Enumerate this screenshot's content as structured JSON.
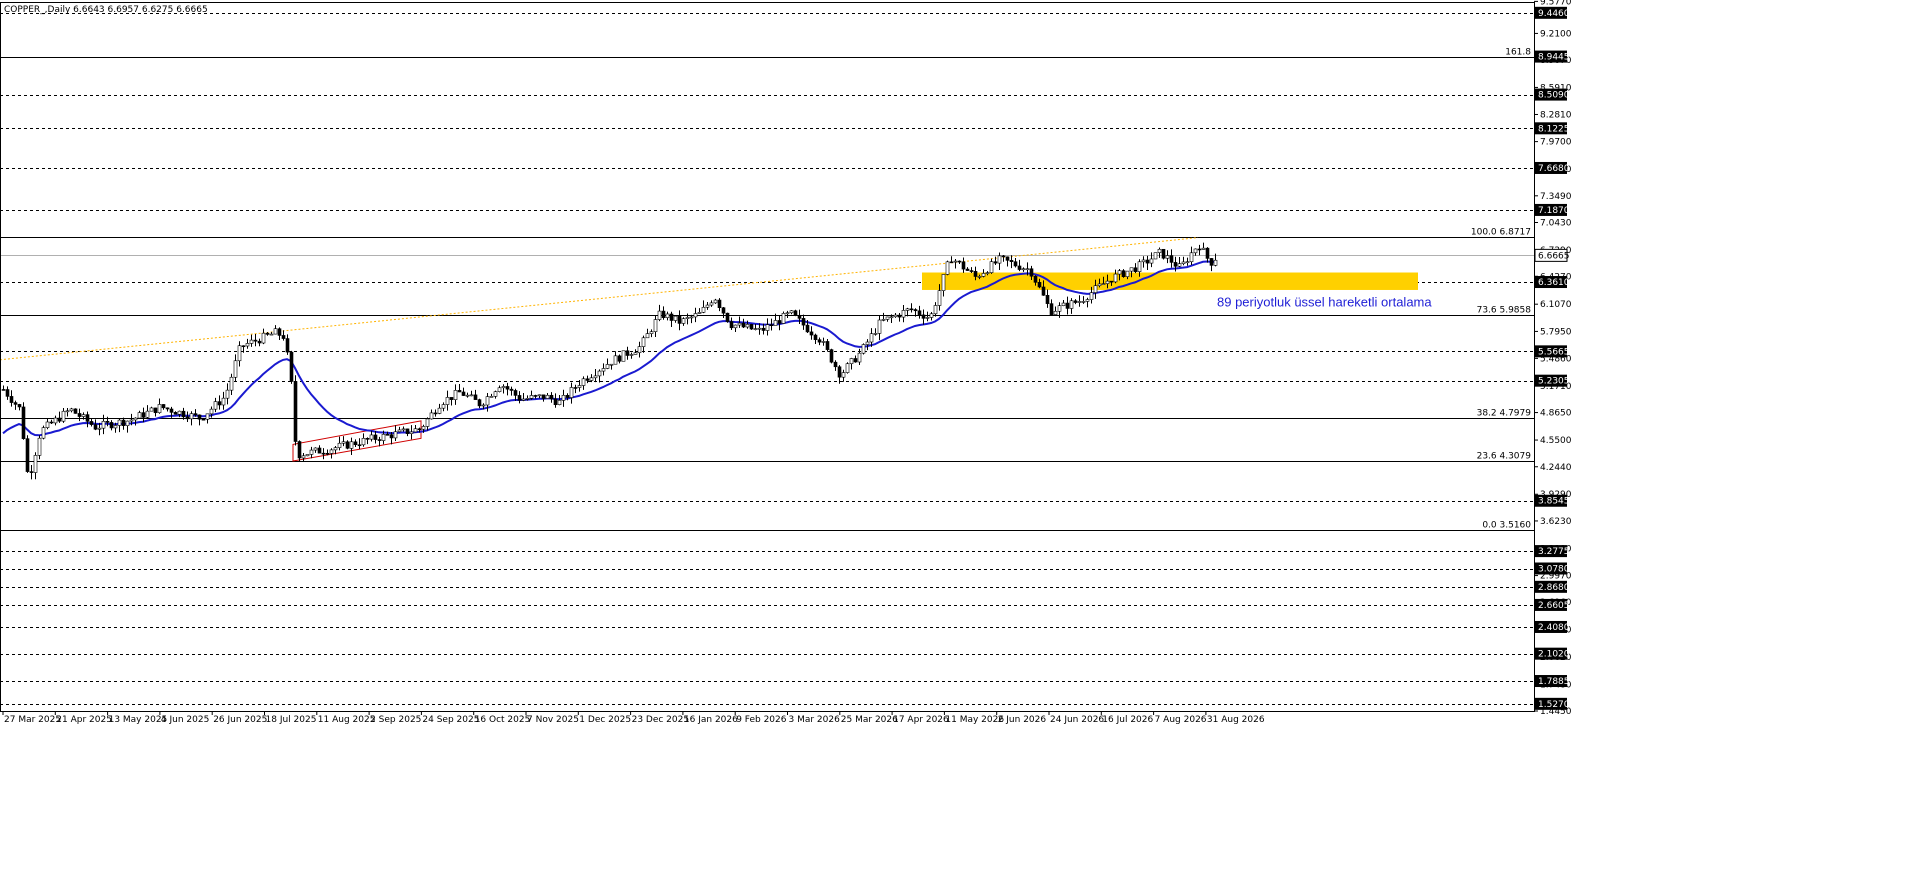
{
  "chart_data": {
    "type": "candlestick",
    "title": "COPPER_,Daily  6.6643 6.6957 6.6275 6.6665",
    "ylim": [
      1.445,
      9.57
    ],
    "grid": false,
    "current_price": 6.6665,
    "x_tick_labels": [
      "27 Mar 2025",
      "21 Apr 2025",
      "13 May 2025",
      "4 Jun 2025",
      "26 Jun 2025",
      "18 Jul 2025",
      "11 Aug 2025",
      "2 Sep 2025",
      "24 Sep 2025",
      "16 Oct 2025",
      "7 Nov 2025",
      "1 Dec 2025",
      "23 Dec 2025",
      "16 Jan 2026",
      "9 Feb 2026",
      "3 Mar 2026",
      "25 Mar 2026",
      "17 Apr 2026",
      "11 May 2026",
      "2 Jun 2026",
      "24 Jun 2026",
      "16 Jul 2026",
      "7 Aug 2026",
      "31 Aug 2026"
    ],
    "y_tick_labels": [
      "9.5770",
      "9.2100",
      "8.9070",
      "8.5910",
      "8.2810",
      "7.9700",
      "7.6590",
      "7.3490",
      "7.0430",
      "6.7290",
      "6.4270",
      "6.1070",
      "5.7950",
      "5.4860",
      "5.1710",
      "4.8650",
      "4.5500",
      "4.2440",
      "3.9290",
      "3.6230",
      "3.3100",
      "2.9970",
      "2.6960",
      "2.3790",
      "2.0620",
      "1.7480",
      "1.4450"
    ],
    "horizontal_levels": [
      {
        "value": 9.446,
        "label": "9.4460",
        "style": "dashed"
      },
      {
        "value": 8.9445,
        "label": "8.9445",
        "style": "solid",
        "left_label": "161.8"
      },
      {
        "value": 8.509,
        "label": "8.5090",
        "style": "dashed"
      },
      {
        "value": 8.1225,
        "label": "8.1225",
        "style": "dashed"
      },
      {
        "value": 7.668,
        "label": "7.6680",
        "style": "dashed"
      },
      {
        "value": 7.187,
        "label": "7.1870",
        "style": "dashed"
      },
      {
        "value": 6.8717,
        "label": "",
        "style": "solid",
        "left_label": "100.0 6.8717"
      },
      {
        "value": 6.361,
        "label": "6.3610",
        "style": "dashed"
      },
      {
        "value": 5.9858,
        "label": "",
        "style": "solid",
        "left_label": "73.6 5.9858"
      },
      {
        "value": 5.5665,
        "label": "5.5665",
        "style": "dashed"
      },
      {
        "value": 5.2305,
        "label": "5.2305",
        "style": "dashed"
      },
      {
        "value": 4.7979,
        "label": "",
        "style": "solid",
        "left_label": "38.2 4.7979"
      },
      {
        "value": 4.3079,
        "label": "",
        "style": "solid",
        "left_label": "23.6 4.3079"
      },
      {
        "value": 3.8545,
        "label": "3.8545",
        "style": "dashed"
      },
      {
        "value": 3.516,
        "label": "",
        "style": "solid",
        "left_label": "0.0 3.5160"
      },
      {
        "value": 3.2775,
        "label": "3.2775",
        "style": "dashed"
      },
      {
        "value": 3.078,
        "label": "3.0780",
        "style": "dashed"
      },
      {
        "value": 2.868,
        "label": "2.8680",
        "style": "dashed"
      },
      {
        "value": 2.6605,
        "label": "2.6605",
        "style": "dashed"
      },
      {
        "value": 2.408,
        "label": "2.4080",
        "style": "dashed"
      },
      {
        "value": 2.102,
        "label": "2.1020",
        "style": "dashed"
      },
      {
        "value": 1.7885,
        "label": "1.7885",
        "style": "dashed"
      },
      {
        "value": 1.527,
        "label": "1.5270",
        "style": "dashed"
      }
    ],
    "price_box": {
      "value": 6.6665,
      "label": "6.6665"
    },
    "zone": {
      "from": 6.27,
      "to": 6.47,
      "color": "#ffd000"
    },
    "ema_label": "89 periyotluk üssel hareketli ortalama",
    "ema_color": "#1a1ad0",
    "trendline_color": "#ffb300",
    "channel_color": "#d00000",
    "up_color": "#ffffff",
    "down_color": "#000000"
  }
}
